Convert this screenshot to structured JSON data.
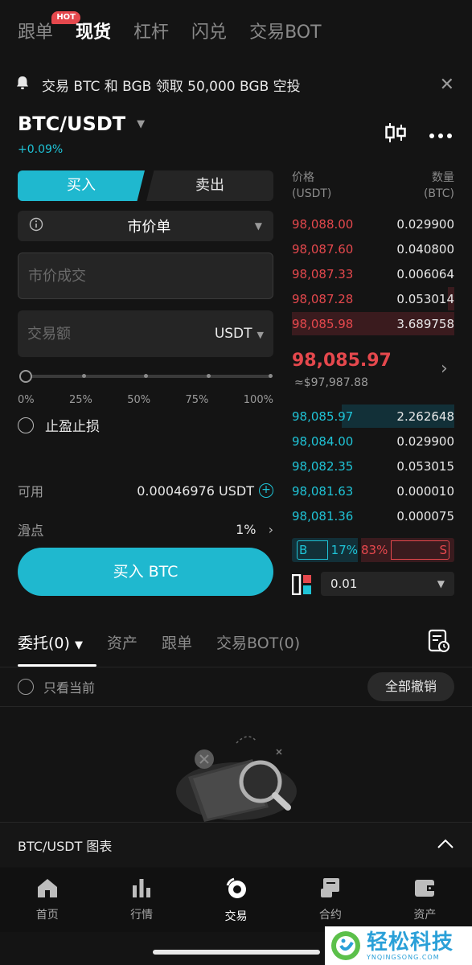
{
  "top_tabs": [
    {
      "label": "跟单",
      "badge": "HOT"
    },
    {
      "label": "现货"
    },
    {
      "label": "杠杆"
    },
    {
      "label": "闪兑"
    },
    {
      "label": "交易BOT"
    }
  ],
  "announcement": {
    "text": "交易 BTC 和 BGB 领取 50,000 BGB 空投",
    "close": "✕"
  },
  "pair": {
    "name": "BTC/USDT",
    "change": "+0.09%"
  },
  "trade": {
    "buy_label": "买入",
    "sell_label": "卖出",
    "order_type": "市价单",
    "price_placeholder": "市价成交",
    "amount_placeholder": "交易额",
    "amount_unit": "USDT",
    "slider_ticks": [
      "0%",
      "25%",
      "50%",
      "75%",
      "100%"
    ],
    "slider_value": 0,
    "tpsl_label": "止盈止损",
    "available_label": "可用",
    "available_value": "0.00046976 USDT",
    "slippage_label": "滑点",
    "slippage_value": "1%",
    "submit_label": "买入 BTC"
  },
  "orderbook": {
    "price_header": "价格",
    "price_unit": "(USDT)",
    "qty_header": "数量",
    "qty_unit": "(BTC)",
    "asks": [
      {
        "price": "98,088.00",
        "qty": "0.029900"
      },
      {
        "price": "98,087.60",
        "qty": "0.040800"
      },
      {
        "price": "98,087.33",
        "qty": "0.006064"
      },
      {
        "price": "98,087.28",
        "qty": "0.053014"
      },
      {
        "price": "98,085.98",
        "qty": "3.689758"
      }
    ],
    "last_price": "98,085.97",
    "last_price_usd": "≈$97,987.88",
    "bids": [
      {
        "price": "98,085.97",
        "qty": "2.262648"
      },
      {
        "price": "98,084.00",
        "qty": "0.029900"
      },
      {
        "price": "98,082.35",
        "qty": "0.053015"
      },
      {
        "price": "98,081.63",
        "qty": "0.000010"
      },
      {
        "price": "98,081.36",
        "qty": "0.000075"
      }
    ],
    "buy_ratio": "17%",
    "sell_ratio": "83%",
    "buy_tag": "B",
    "sell_tag": "S",
    "precision": "0.01"
  },
  "orders": {
    "tabs": [
      "委托(0)",
      "资产",
      "跟单",
      "交易BOT(0)"
    ],
    "current_only": "只看当前",
    "cancel_all": "全部撤销"
  },
  "chart_bar": {
    "label": "BTC/USDT  图表"
  },
  "nav": [
    {
      "label": "首页",
      "icon": "home-icon"
    },
    {
      "label": "行情",
      "icon": "market-icon"
    },
    {
      "label": "交易",
      "icon": "trade-icon"
    },
    {
      "label": "合约",
      "icon": "contract-icon"
    },
    {
      "label": "资产",
      "icon": "wallet-icon"
    }
  ],
  "watermark": {
    "name": "轻松科技",
    "domain": "YNQINGSONG.COM"
  },
  "colors": {
    "accent": "#1fb8cf",
    "ask": "#e5484d",
    "bid": "#1fc3d6",
    "bg": "#141414"
  }
}
